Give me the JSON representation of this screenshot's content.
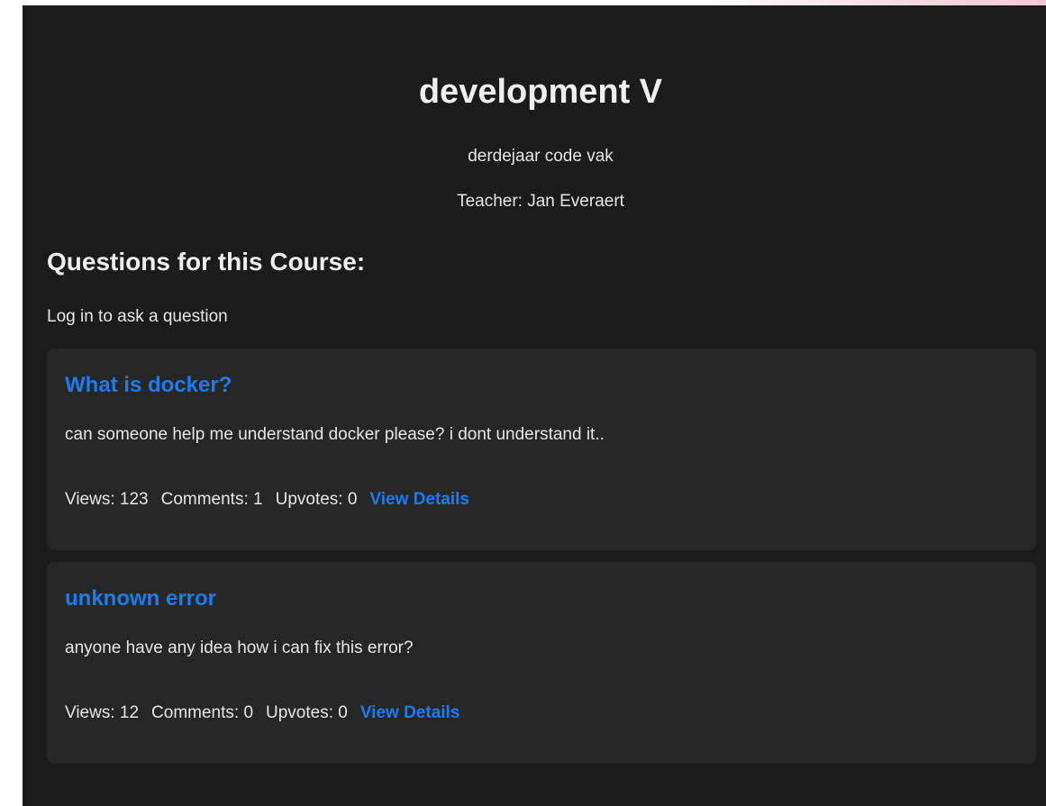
{
  "course": {
    "title": "development V",
    "subtitle": "derdejaar code vak",
    "teacher": "Teacher: Jan Everaert"
  },
  "questions_section": {
    "heading": "Questions for this Course:",
    "login_prompt": "Log in to ask a question"
  },
  "questions": [
    {
      "title": "What is docker?",
      "body": "can someone help me understand docker please? i dont understand it..",
      "views": "Views: 123",
      "comments": "Comments: 1",
      "upvotes": "Upvotes: 0",
      "details_label": "View Details"
    },
    {
      "title": "unknown error",
      "body": "anyone have any idea how i can fix this error?",
      "views": "Views: 12",
      "comments": "Comments: 0",
      "upvotes": "Upvotes: 0",
      "details_label": "View Details"
    }
  ],
  "colors": {
    "background": "#1b1b1b",
    "card": "#262626",
    "accent": "#1a7cf0",
    "text": "#e6e6e6"
  }
}
